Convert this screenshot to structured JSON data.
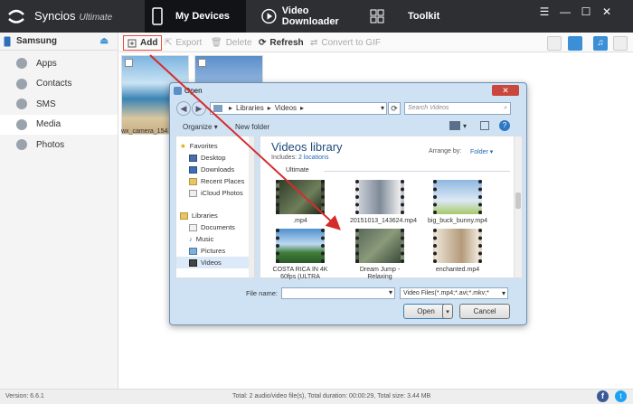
{
  "app": {
    "name": "Syncios",
    "edition": "Ultimate"
  },
  "nav_tabs": [
    {
      "label": "My Devices"
    },
    {
      "label": "Video Downloader"
    },
    {
      "label": "Toolkit"
    }
  ],
  "sidebar": {
    "device": "Samsung",
    "items": [
      {
        "label": "Apps"
      },
      {
        "label": "Contacts"
      },
      {
        "label": "SMS"
      },
      {
        "label": "Media"
      },
      {
        "label": "Photos"
      }
    ]
  },
  "toolbar": {
    "add": "Add",
    "export": "Export",
    "delete": "Delete",
    "refresh": "Refresh",
    "convert": "Convert to GIF"
  },
  "media": {
    "thumb_label": "wx_camera_154"
  },
  "status": {
    "version": "Version: 6.6.1",
    "summary": "Total: 2 audio/video file(s), Total duration: 00:00:29, Total size: 3.44 MB"
  },
  "dialog": {
    "title": "Open",
    "address": [
      "Libraries",
      "Videos"
    ],
    "search_placeholder": "Search Videos",
    "organize": "Organize",
    "new_folder": "New folder",
    "nav": {
      "favorites_header": "Favorites",
      "favorites": [
        "Desktop",
        "Downloads",
        "Recent Places",
        "iCloud Photos"
      ],
      "libraries_header": "Libraries",
      "libraries": [
        "Documents",
        "Music",
        "Pictures",
        "Videos"
      ]
    },
    "library_title": "Videos library",
    "includes_prefix": "Includes:",
    "includes_link": "2 locations",
    "arrange_label": "Arrange by:",
    "arrange_value": "Folder",
    "group_label": "Ultimate",
    "files": [
      {
        "name": ".mp4"
      },
      {
        "name": "20151013_143624.mp4"
      },
      {
        "name": "big_buck_bunny.mp4"
      },
      {
        "name": "COSTA RICA IN 4K 60fps (ULTRA"
      },
      {
        "name": "Dream Jump - Relaxing"
      },
      {
        "name": "enchanted.mp4"
      }
    ],
    "file_name_label": "File name:",
    "file_name_value": "",
    "file_type": "Video Files(*.mp4;*.avi;*.mkv;*",
    "open_btn": "Open",
    "cancel_btn": "Cancel"
  },
  "colors": {
    "accent": "#3a8fd6",
    "titlebar": "#2d2f33",
    "highlight": "#e74c3c",
    "annotation_arrow": "#d62b2b"
  }
}
